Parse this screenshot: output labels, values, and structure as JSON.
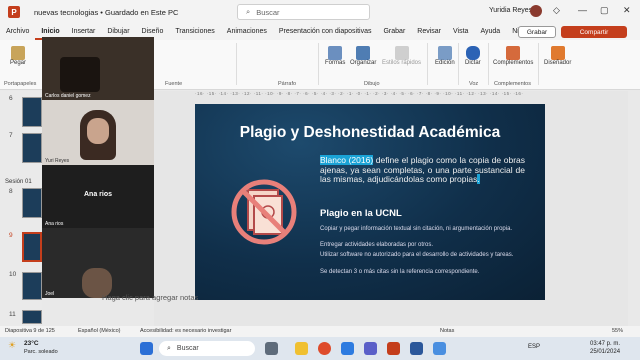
{
  "titlebar": {
    "doc_title": "nuevas tecnologias • Guardado en Este PC",
    "search_placeholder": "Buscar",
    "user_name": "Yuridia Reyes",
    "minimize": "—",
    "maximize": "▢",
    "close": "✕"
  },
  "menu": {
    "items": [
      "Archivo",
      "Inicio",
      "Insertar",
      "Dibujar",
      "Diseño",
      "Transiciones",
      "Animaciones",
      "Presentación con diapositivas",
      "Grabar",
      "Revisar",
      "Vista",
      "Ayuda",
      "Nitro PDF Pro"
    ],
    "grabar": "Grabar",
    "compartir": "Compartir"
  },
  "ribbon": {
    "pegar": "Pegar",
    "formas": "Formas",
    "organizar": "Organizar",
    "estilos": "Estilos rápidos",
    "edicion": "Edición",
    "dictar": "Dictar",
    "complementos": "Complementos",
    "disenador": "Diseñador",
    "groups": {
      "portapapeles": "Portapapeles",
      "fuente": "Fuente",
      "parrafo": "Párrafo",
      "dibujo": "Dibujo",
      "voz": "Voz",
      "complementos": "Complementos"
    }
  },
  "slide_panel": {
    "numbers": [
      "6",
      "7",
      "8",
      "9",
      "10",
      "11"
    ],
    "section": "Sesión 01"
  },
  "participants": [
    "Carlos daniel gomez",
    "Yuri Reyes",
    "Ana rios",
    "Ana rios",
    "Joel"
  ],
  "ruler": "·16· ·15· ·14· ·13· ·12· ·11· ·10· ·9· ·8· ·7· ·6· ·5· ·4· ·3· ·2· ·1· ·0· ·1· ·2· ·3· ·4· ·5· ·6· ·7· ·8· ·9· ·10· ·11· ·12· ·13· ·14· ·15· ·16·",
  "slide": {
    "title": "Plagio y Deshonestidad Académica",
    "citation": "Blanco (2016)",
    "body_a": " define el plagio ",
    "body_b": "como la copia de obras ajenas, ya sean completas, o una parte sustancial de las mismas, adjudicándolas como propias",
    "body_end": ".",
    "subtitle": "Plagio en la UCNL",
    "items": [
      "Copiar y pegar información textual sin citación, ni argumentación propia.",
      "Entregar actividades elaboradas por otros.",
      "Utilizar software no autorizado para el desarrollo de actividades y tareas.",
      "Se detectan 3 o más citas sin la referencia correspondiente."
    ]
  },
  "notes_placeholder": "Haga clic para agregar notas",
  "statusbar": {
    "slide_info": "Diapositiva 9 de 125",
    "language": "Español (México)",
    "accessibility": "Accesibilidad: es necesario investigar",
    "notes": "Notas",
    "zoom": "55%"
  },
  "taskbar": {
    "temp": "23°C",
    "weather": "Parc. soleado",
    "search": "Buscar",
    "lang": "ESP",
    "time": "03:47 p. m.",
    "date": "25/01/2024"
  },
  "colors": {
    "accent": "#c43e1c",
    "slide_bg": "#102f4a",
    "highlight": "#1aa3d6"
  }
}
